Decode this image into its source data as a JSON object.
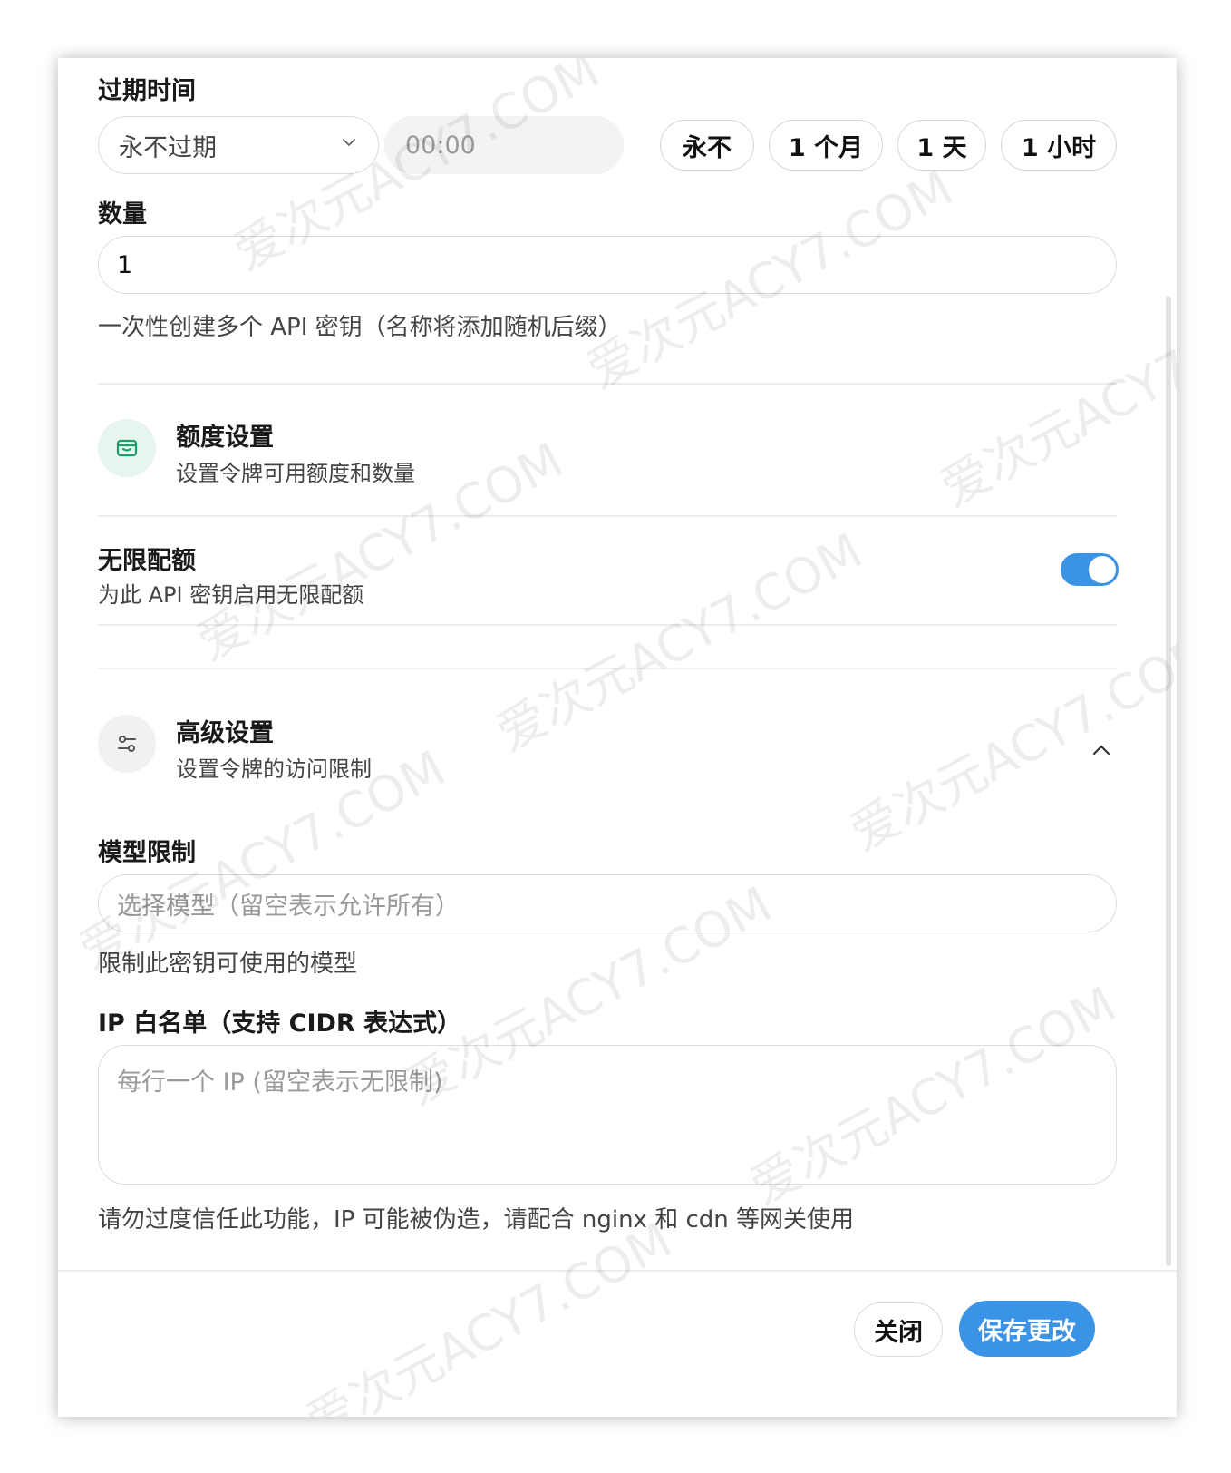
{
  "expiry": {
    "label": "过期时间",
    "select_value": "永不过期",
    "time_placeholder": "00:00",
    "quick_buttons": [
      "永不",
      "1 个月",
      "1 天",
      "1 小时"
    ]
  },
  "quantity": {
    "label": "数量",
    "value": "1",
    "hint": "一次性创建多个 API 密钥（名称将添加随机后缀）"
  },
  "quota_section": {
    "title": "额度设置",
    "subtitle": "设置令牌可用额度和数量",
    "icon": "wallet-icon",
    "accent": "#1a9c6b"
  },
  "unlimited": {
    "label": "无限配额",
    "hint": "为此 API 密钥启用无限配额",
    "enabled": true
  },
  "advanced_section": {
    "title": "高级设置",
    "subtitle": "设置令牌的访问限制",
    "icon": "sliders-icon"
  },
  "model_limit": {
    "label": "模型限制",
    "placeholder": "选择模型（留空表示允许所有）",
    "hint": "限制此密钥可使用的模型"
  },
  "ip_whitelist": {
    "label": "IP 白名单（支持 CIDR 表达式）",
    "placeholder": "每行一个 IP (留空表示无限制)",
    "hint": "请勿过度信任此功能，IP 可能被伪造，请配合 nginx 和 cdn 等网关使用"
  },
  "footer": {
    "close_label": "关闭",
    "save_label": "保存更改"
  },
  "colors": {
    "primary": "#3b93e6"
  },
  "watermark": "爱次元ACY7.COM"
}
